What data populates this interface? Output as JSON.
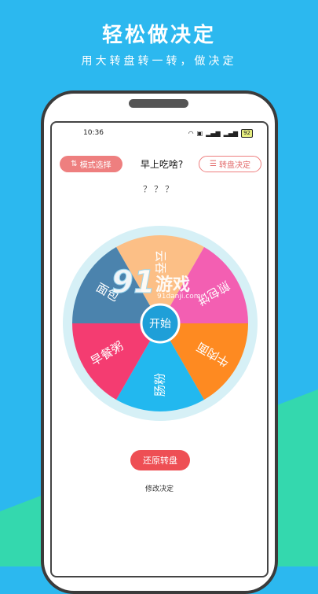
{
  "headline": {
    "title": "轻松做决定",
    "subtitle": "用大转盘转一转，做决定"
  },
  "statusbar": {
    "time": "10:36",
    "battery": "92",
    "icons": [
      "wifi-icon",
      "hd-icon",
      "signal-icon",
      "signal-icon-2",
      "battery-icon"
    ]
  },
  "toolbar": {
    "mode_label": "模式选择",
    "title": "早上吃啥?",
    "decide_label": "转盘决定"
  },
  "result": "？？？",
  "wheel": {
    "center_label": "开始",
    "segments": [
      {
        "label": "云吞",
        "color": "#fcbf86"
      },
      {
        "label": "煎包饼",
        "color": "#f35fb2"
      },
      {
        "label": "牛肉面",
        "color": "#fe8a21"
      },
      {
        "label": "肠粉",
        "color": "#22b8ef"
      },
      {
        "label": "早餐粥",
        "color": "#f43c71"
      },
      {
        "label": "面包",
        "color": "#4b83ad"
      }
    ]
  },
  "actions": {
    "reset_label": "还原转盘",
    "modify_label": "修改决定"
  },
  "watermark": {
    "number": "91",
    "text": "游戏",
    "url": "91danji.com"
  },
  "colors": {
    "background_top": "#2cb8ef",
    "background_bottom": "#33d6b0",
    "accent": "#ee4f54"
  }
}
